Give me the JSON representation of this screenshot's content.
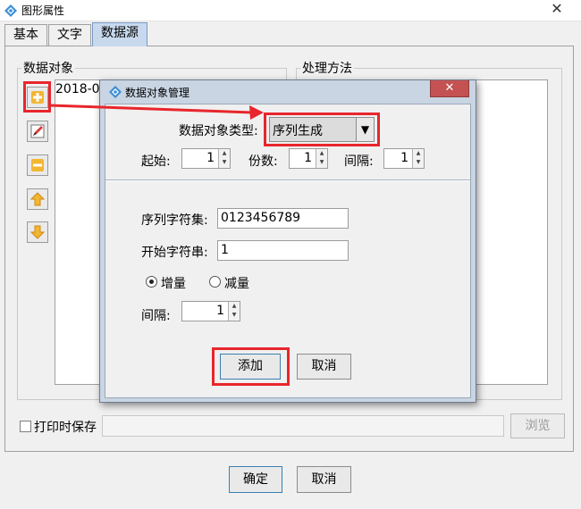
{
  "window": {
    "title": "图形属性",
    "close_label": "✕"
  },
  "tabs": [
    {
      "label": "基本"
    },
    {
      "label": "文字"
    },
    {
      "label": "数据源"
    }
  ],
  "data_object_group": {
    "label": "数据对象",
    "list_item": "2018-07"
  },
  "processing_group": {
    "label": "处理方法"
  },
  "side_buttons": [
    "add-icon",
    "edit-icon",
    "remove-icon",
    "move-up-icon",
    "move-down-icon"
  ],
  "print_save": {
    "label": "打印时保存",
    "checked": false,
    "path_value": "",
    "browse_label": "浏览"
  },
  "footer": {
    "ok_label": "确定",
    "cancel_label": "取消"
  },
  "dialog": {
    "title": "数据对象管理",
    "close_label": "✕",
    "type_label": "数据对象类型:",
    "type_value": "序列生成",
    "start_label": "起始:",
    "start_value": "1",
    "copies_label": "份数:",
    "copies_value": "1",
    "interval_label": "间隔:",
    "interval_value": "1",
    "charset_label": "序列字符集:",
    "charset_value": "0123456789",
    "start_string_label": "开始字符串:",
    "start_string_value": "1",
    "increment_label": "增量",
    "decrement_label": "减量",
    "selected_direction": "增量",
    "interval2_label": "间隔:",
    "interval2_value": "1",
    "add_label": "添加",
    "cancel_label": "取消"
  },
  "colors": {
    "highlight_red": "#e8262c",
    "arrow_red": "#e8262c",
    "selected_tab": "#c8d9ee",
    "dialog_frame": "#c9d5e3"
  }
}
